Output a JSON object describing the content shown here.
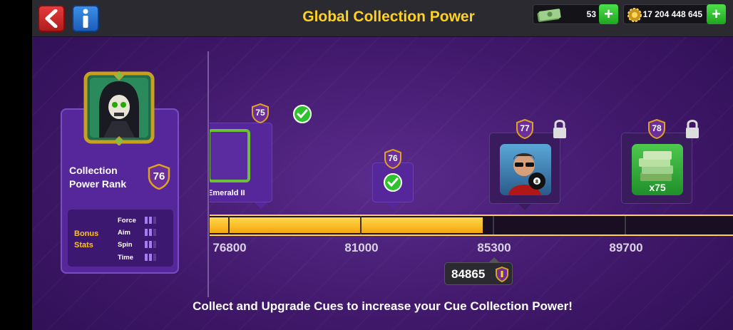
{
  "header": {
    "title": "Global Collection Power",
    "cash": "53",
    "coins": "17 204 448 645",
    "back_icon": "chevron-left-icon",
    "info_icon": "info-icon"
  },
  "rank": {
    "label_line1": "Collection",
    "label_line2": "Power Rank",
    "value": "76"
  },
  "bonus": {
    "label_line1": "Bonus",
    "label_line2": "Stats",
    "stats": [
      {
        "name": "Force",
        "level": 2
      },
      {
        "name": "Aim",
        "level": 2
      },
      {
        "name": "Spin",
        "level": 2
      },
      {
        "name": "Time",
        "level": 2
      }
    ]
  },
  "milestones": [
    {
      "level": "75",
      "value": "76800",
      "reward_name": "Emerald II",
      "claimed": true
    },
    {
      "level": "76",
      "value": "81000",
      "claimed": true
    },
    {
      "level": "77",
      "value": "85300",
      "locked": true
    },
    {
      "level": "78",
      "value": "89700",
      "reward_amount": "x75",
      "locked": true
    }
  ],
  "current_power": "84865",
  "progress_fraction": 0.517,
  "footer_text": "Collect and Upgrade Cues to increase your Cue Collection Power!",
  "colors": {
    "title": "#ffd21f",
    "progress": "#f3a60e",
    "panel": "#55279a",
    "bonus_label": "#ffc21a"
  }
}
